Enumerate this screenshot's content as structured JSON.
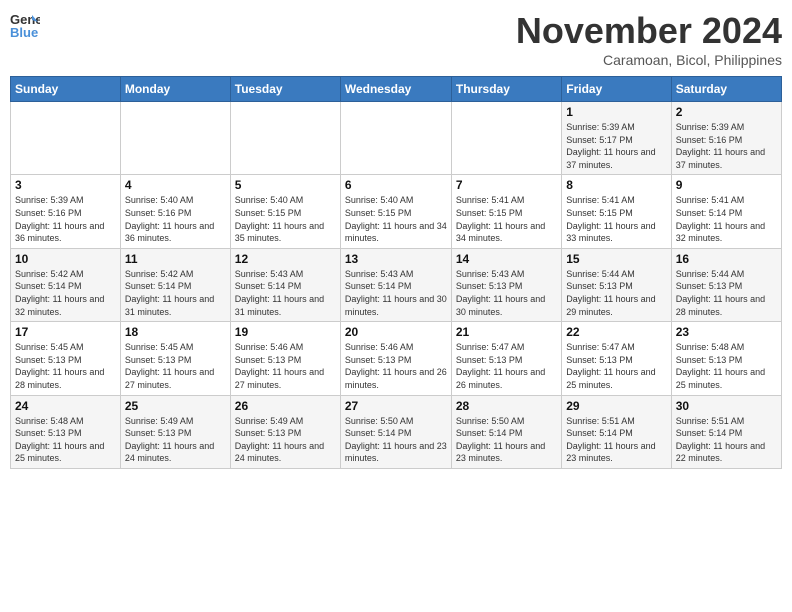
{
  "logo": {
    "line1": "General",
    "line2": "Blue"
  },
  "title": "November 2024",
  "location": "Caramoan, Bicol, Philippines",
  "weekdays": [
    "Sunday",
    "Monday",
    "Tuesday",
    "Wednesday",
    "Thursday",
    "Friday",
    "Saturday"
  ],
  "weeks": [
    [
      {
        "day": "",
        "info": ""
      },
      {
        "day": "",
        "info": ""
      },
      {
        "day": "",
        "info": ""
      },
      {
        "day": "",
        "info": ""
      },
      {
        "day": "",
        "info": ""
      },
      {
        "day": "1",
        "info": "Sunrise: 5:39 AM\nSunset: 5:17 PM\nDaylight: 11 hours and 37 minutes."
      },
      {
        "day": "2",
        "info": "Sunrise: 5:39 AM\nSunset: 5:16 PM\nDaylight: 11 hours and 37 minutes."
      }
    ],
    [
      {
        "day": "3",
        "info": "Sunrise: 5:39 AM\nSunset: 5:16 PM\nDaylight: 11 hours and 36 minutes."
      },
      {
        "day": "4",
        "info": "Sunrise: 5:40 AM\nSunset: 5:16 PM\nDaylight: 11 hours and 36 minutes."
      },
      {
        "day": "5",
        "info": "Sunrise: 5:40 AM\nSunset: 5:15 PM\nDaylight: 11 hours and 35 minutes."
      },
      {
        "day": "6",
        "info": "Sunrise: 5:40 AM\nSunset: 5:15 PM\nDaylight: 11 hours and 34 minutes."
      },
      {
        "day": "7",
        "info": "Sunrise: 5:41 AM\nSunset: 5:15 PM\nDaylight: 11 hours and 34 minutes."
      },
      {
        "day": "8",
        "info": "Sunrise: 5:41 AM\nSunset: 5:15 PM\nDaylight: 11 hours and 33 minutes."
      },
      {
        "day": "9",
        "info": "Sunrise: 5:41 AM\nSunset: 5:14 PM\nDaylight: 11 hours and 32 minutes."
      }
    ],
    [
      {
        "day": "10",
        "info": "Sunrise: 5:42 AM\nSunset: 5:14 PM\nDaylight: 11 hours and 32 minutes."
      },
      {
        "day": "11",
        "info": "Sunrise: 5:42 AM\nSunset: 5:14 PM\nDaylight: 11 hours and 31 minutes."
      },
      {
        "day": "12",
        "info": "Sunrise: 5:43 AM\nSunset: 5:14 PM\nDaylight: 11 hours and 31 minutes."
      },
      {
        "day": "13",
        "info": "Sunrise: 5:43 AM\nSunset: 5:14 PM\nDaylight: 11 hours and 30 minutes."
      },
      {
        "day": "14",
        "info": "Sunrise: 5:43 AM\nSunset: 5:13 PM\nDaylight: 11 hours and 30 minutes."
      },
      {
        "day": "15",
        "info": "Sunrise: 5:44 AM\nSunset: 5:13 PM\nDaylight: 11 hours and 29 minutes."
      },
      {
        "day": "16",
        "info": "Sunrise: 5:44 AM\nSunset: 5:13 PM\nDaylight: 11 hours and 28 minutes."
      }
    ],
    [
      {
        "day": "17",
        "info": "Sunrise: 5:45 AM\nSunset: 5:13 PM\nDaylight: 11 hours and 28 minutes."
      },
      {
        "day": "18",
        "info": "Sunrise: 5:45 AM\nSunset: 5:13 PM\nDaylight: 11 hours and 27 minutes."
      },
      {
        "day": "19",
        "info": "Sunrise: 5:46 AM\nSunset: 5:13 PM\nDaylight: 11 hours and 27 minutes."
      },
      {
        "day": "20",
        "info": "Sunrise: 5:46 AM\nSunset: 5:13 PM\nDaylight: 11 hours and 26 minutes."
      },
      {
        "day": "21",
        "info": "Sunrise: 5:47 AM\nSunset: 5:13 PM\nDaylight: 11 hours and 26 minutes."
      },
      {
        "day": "22",
        "info": "Sunrise: 5:47 AM\nSunset: 5:13 PM\nDaylight: 11 hours and 25 minutes."
      },
      {
        "day": "23",
        "info": "Sunrise: 5:48 AM\nSunset: 5:13 PM\nDaylight: 11 hours and 25 minutes."
      }
    ],
    [
      {
        "day": "24",
        "info": "Sunrise: 5:48 AM\nSunset: 5:13 PM\nDaylight: 11 hours and 25 minutes."
      },
      {
        "day": "25",
        "info": "Sunrise: 5:49 AM\nSunset: 5:13 PM\nDaylight: 11 hours and 24 minutes."
      },
      {
        "day": "26",
        "info": "Sunrise: 5:49 AM\nSunset: 5:13 PM\nDaylight: 11 hours and 24 minutes."
      },
      {
        "day": "27",
        "info": "Sunrise: 5:50 AM\nSunset: 5:14 PM\nDaylight: 11 hours and 23 minutes."
      },
      {
        "day": "28",
        "info": "Sunrise: 5:50 AM\nSunset: 5:14 PM\nDaylight: 11 hours and 23 minutes."
      },
      {
        "day": "29",
        "info": "Sunrise: 5:51 AM\nSunset: 5:14 PM\nDaylight: 11 hours and 23 minutes."
      },
      {
        "day": "30",
        "info": "Sunrise: 5:51 AM\nSunset: 5:14 PM\nDaylight: 11 hours and 22 minutes."
      }
    ]
  ]
}
